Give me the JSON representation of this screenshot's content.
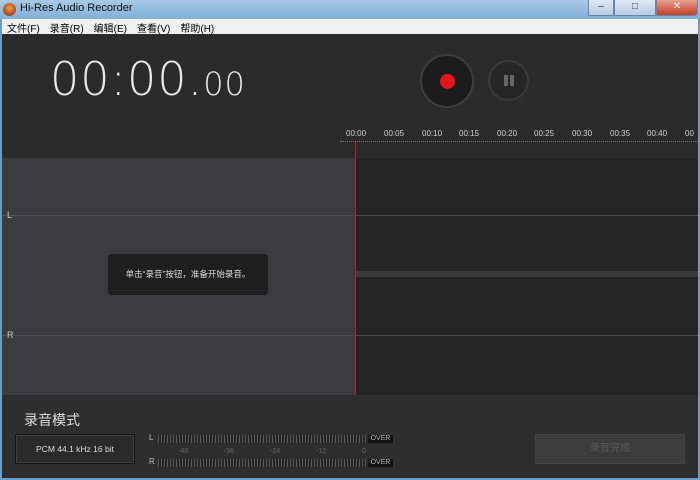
{
  "window": {
    "title": "Hi-Res Audio Recorder",
    "minimize": "–",
    "maximize": "□",
    "close": "✕"
  },
  "menu": [
    "文件(F)",
    "录音(R)",
    "编辑(E)",
    "查看(V)",
    "帮助(H)"
  ],
  "timer": {
    "main": "00:00.",
    "fraction": "00"
  },
  "ruler": [
    "00:00",
    "00:05",
    "00:10",
    "00:15",
    "00:20",
    "00:25",
    "00:30",
    "00:35",
    "00:40",
    "00"
  ],
  "tracks": {
    "left_label": "L",
    "right_label": "R",
    "tooltip": "单击“录音”按钮，准备开始录音。"
  },
  "bottom": {
    "mode_label": "录音模式",
    "format": "PCM   44.1 kHz   16 bit",
    "meter_l": "L",
    "meter_r": "R",
    "over": "OVER",
    "scale": [
      "-48",
      "-36",
      "-24",
      "-12",
      "0"
    ],
    "done_button": "录音完成"
  },
  "colors": {
    "record": "#e8141b",
    "playhead": "#b02030"
  }
}
